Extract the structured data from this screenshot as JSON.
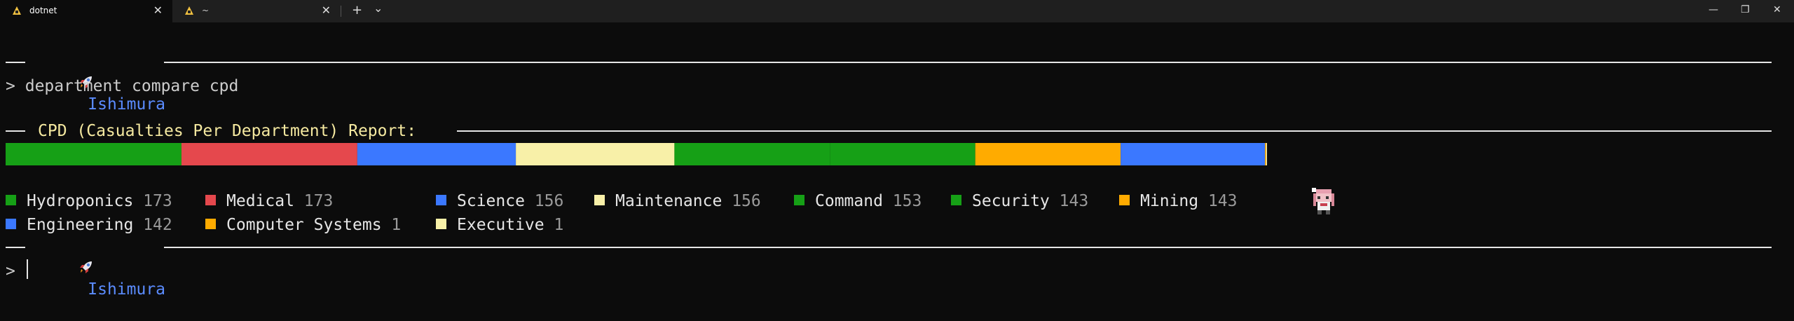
{
  "tabs": [
    {
      "label": "dotnet",
      "close": "✕"
    },
    {
      "label": "~",
      "close": "✕"
    }
  ],
  "tab_controls": {
    "new_tab": "+",
    "dropdown": "⌄"
  },
  "window_controls": {
    "minimize": "—",
    "maximize": "❐",
    "close": "✕"
  },
  "terminal": {
    "prompt_header_1": {
      "name": "Ishimura"
    },
    "command_line": {
      "prompt": ">",
      "command": "department compare cpd"
    },
    "report_header": "CPD (Casualties Per Department) Report:",
    "chart_data": {
      "type": "bar",
      "title": "CPD (Casualties Per Department) Report:",
      "categories": [
        "Hydroponics",
        "Medical",
        "Science",
        "Maintenance",
        "Command",
        "Security",
        "Mining",
        "Engineering",
        "Computer Systems",
        "Executive"
      ],
      "values": [
        173,
        173,
        156,
        156,
        153,
        143,
        143,
        142,
        1,
        1
      ],
      "colors": [
        "#16a016",
        "#e5484d",
        "#3b78ff",
        "#f8f0a8",
        "#16a016",
        "#16a016",
        "#ffab00",
        "#3b78ff",
        "#ffab00",
        "#f8f0a8"
      ]
    },
    "legend": [
      {
        "name": "Hydroponics",
        "value": "173",
        "color": "#16a016"
      },
      {
        "name": "Medical",
        "value": "173",
        "color": "#e5484d"
      },
      {
        "name": "Science",
        "value": "156",
        "color": "#3b78ff"
      },
      {
        "name": "Maintenance",
        "value": "156",
        "color": "#f8f0a8"
      },
      {
        "name": "Command",
        "value": "153",
        "color": "#16a016"
      },
      {
        "name": "Security",
        "value": "143",
        "color": "#16a016"
      },
      {
        "name": "Mining",
        "value": "143",
        "color": "#ffab00"
      },
      {
        "name": "Engineering",
        "value": "142",
        "color": "#3b78ff"
      },
      {
        "name": "Computer Systems",
        "value": "1",
        "color": "#ffab00"
      },
      {
        "name": "Executive",
        "value": "1",
        "color": "#f8f0a8"
      }
    ],
    "prompt_header_2": {
      "name": "Ishimura"
    },
    "input_line": {
      "prompt": ">",
      "value": ""
    }
  },
  "icons": {
    "rocket": "rocket-icon",
    "tab_icon": "linux-penguin-icon",
    "sprite": "pixel-character-sprite"
  }
}
